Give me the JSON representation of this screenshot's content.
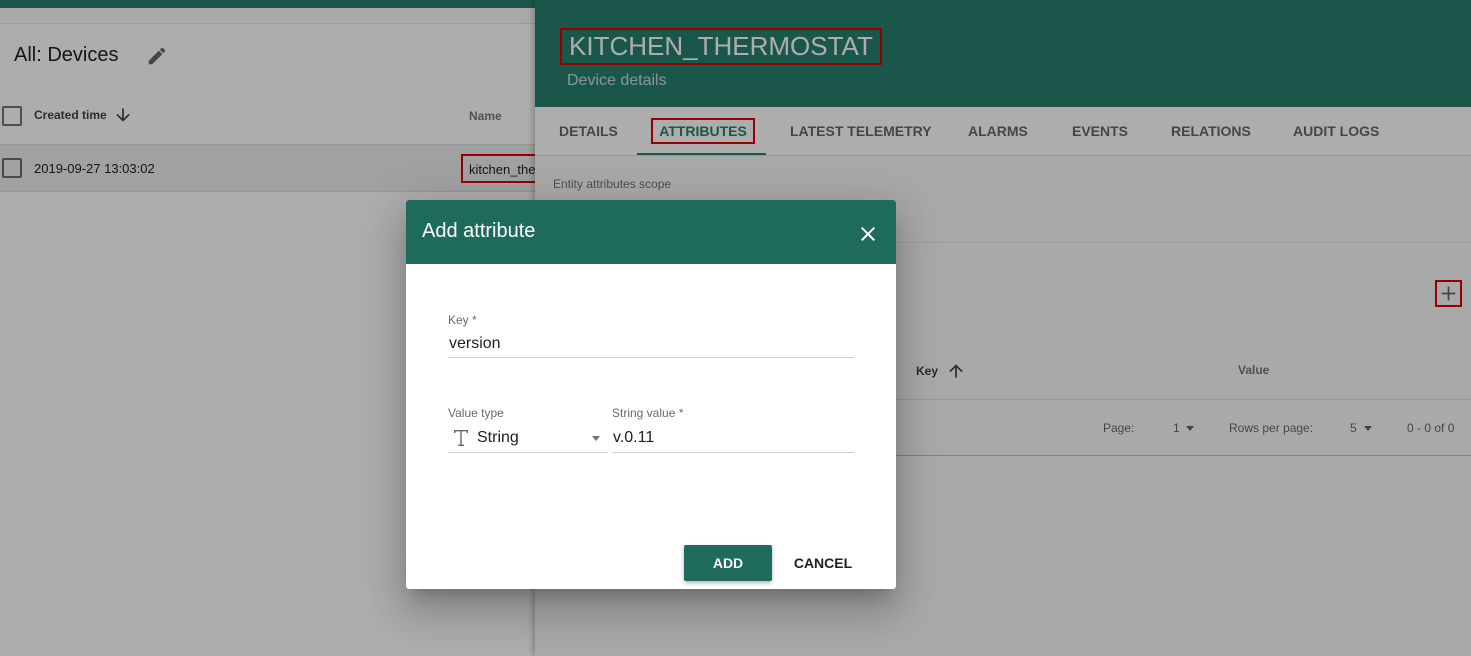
{
  "device_list": {
    "title": "All: Devices",
    "columns": {
      "created_time": "Created time",
      "name": "Name"
    },
    "rows": [
      {
        "created_time": "2019-09-27 13:03:02",
        "name": "kitchen_the"
      }
    ]
  },
  "details": {
    "title": "KITCHEN_THERMOSTAT",
    "subtitle": "Device details",
    "tabs": [
      "DETAILS",
      "ATTRIBUTES",
      "LATEST TELEMETRY",
      "ALARMS",
      "EVENTS",
      "RELATIONS",
      "AUDIT LOGS"
    ],
    "active_tab": "ATTRIBUTES",
    "scope_label": "Entity attributes scope",
    "attributes_table": {
      "columns": {
        "key": "Key",
        "value": "Value"
      },
      "pager": {
        "page_label": "Page:",
        "page_value": "1",
        "rows_label": "Rows per page:",
        "rows_value": "5",
        "range": "0 - 0 of 0"
      }
    }
  },
  "dialog": {
    "title": "Add attribute",
    "key_label": "Key *",
    "key_value": "version",
    "value_type_label": "Value type",
    "value_type": "String",
    "string_value_label": "String value *",
    "string_value": "v.0.11",
    "add_label": "ADD",
    "cancel_label": "CANCEL"
  },
  "colors": {
    "header_teal": "#27806e",
    "dialog_teal": "#1e6b5c",
    "highlight_red": "#e00000"
  }
}
